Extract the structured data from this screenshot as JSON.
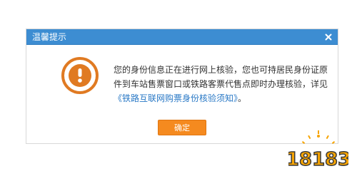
{
  "dialog": {
    "title": "温馨提示",
    "close_symbol": "×",
    "message_part1": "您的身份信息正在进行网上核验，您也可持居民身份证原件到车站售票窗口或铁路客票代售点即时办理核验，详见",
    "message_link": "《铁路互联网购票身份核验须知》",
    "message_part2": "。",
    "confirm_label": "确定",
    "icon": "exclamation-circle-icon"
  },
  "watermark": {
    "text": "18183",
    "icon": "site-logo"
  },
  "colors": {
    "titlebar": "#3d8dd2",
    "accent": "#f58a1f",
    "link": "#2a79c6"
  }
}
